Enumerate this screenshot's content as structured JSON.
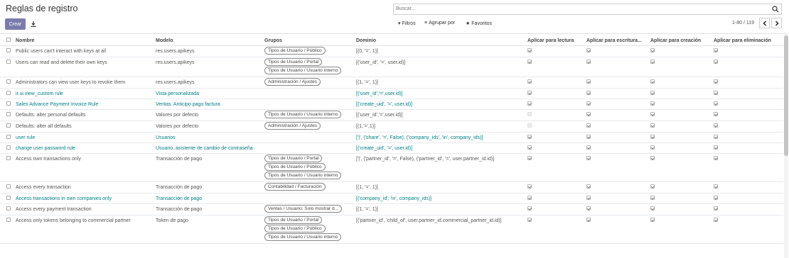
{
  "header": {
    "title": "Reglas de registro",
    "search_placeholder": "Buscar...",
    "create_label": "Crear",
    "filters_label": "Filtros",
    "groupby_label": "Agrupar por",
    "favorites_label": "Favoritos",
    "pager": "1-80 / 119"
  },
  "columns": {
    "name": "Nombre",
    "model": "Modelo",
    "groups": "Grupos",
    "domain": "Dominio",
    "read": "Aplicar para lectura",
    "write": "Aplicar para escritura...",
    "create": "Aplicar para creación",
    "unlink": "Aplicar para eliminación"
  },
  "rows": [
    {
      "name": "Public users can't interact with keys at all",
      "model": "res.users.apikeys",
      "groups": [
        "Tipos de Usuario / Público"
      ],
      "domain": "[(0, '=', 1)]",
      "perms": [
        true,
        true,
        true,
        true
      ],
      "link": false
    },
    {
      "name": "Users can read and delete their own keys",
      "model": "res.users.apikeys",
      "groups": [
        "Tipos de Usuario / Portal",
        "Tipos de Usuario / Usuario interno"
      ],
      "domain": "[('user_id', '=', user.id)]",
      "perms": [
        true,
        true,
        true,
        true
      ],
      "link": false
    },
    {
      "name": "Administrators can view user keys to revoke them",
      "model": "res.users.apikeys",
      "groups": [
        "Administración / Ajustes"
      ],
      "domain": "[(1, '=', 1)]",
      "perms": [
        true,
        true,
        true,
        true
      ],
      "link": false
    },
    {
      "name": "ir.ui.view_custom rule",
      "model": "Vista personalizada",
      "groups": [],
      "domain": "[('user_id','=',user.id)]",
      "perms": [
        true,
        true,
        true,
        true
      ],
      "link": true
    },
    {
      "name": "Sales Advance Payment Invoice Rule",
      "model": "Ventas. Anticipo pago factura",
      "groups": [],
      "domain": "[('create_uid', '=', user.id)]",
      "perms": [
        true,
        true,
        true,
        true
      ],
      "link": true
    },
    {
      "name": "Defaults: alter personal defaults",
      "model": "Valores por defecto",
      "groups": [
        "Tipos de Usuario / Usuario interno"
      ],
      "domain": "[('user_id','=',user.id)]",
      "perms": [
        false,
        true,
        true,
        true
      ],
      "link": false
    },
    {
      "name": "Defaults: alter all defaults",
      "model": "Valores por defecto",
      "groups": [
        "Administración / Ajustes"
      ],
      "domain": "[(1,'=',1)]",
      "perms": [
        false,
        true,
        true,
        true
      ],
      "link": false
    },
    {
      "name": "user rule",
      "model": "Usuarios",
      "groups": [],
      "domain": "['|', ('share', '=', False), ('company_ids', 'in', company_ids)]",
      "perms": [
        true,
        true,
        true,
        true
      ],
      "link": true
    },
    {
      "name": "change user password rule",
      "model": "Usuario, asistente de cambio de contraseña",
      "groups": [],
      "domain": "[('create_uid', '=', user.id)]",
      "perms": [
        true,
        true,
        true,
        true
      ],
      "link": true
    },
    {
      "name": "Access own transactions only",
      "model": "Transacción de pago",
      "groups": [
        "Tipos de Usuario / Portal",
        "Tipos de Usuario / Público",
        "Tipos de Usuario / Usuario interno"
      ],
      "domain": "['|', ('partner_id', '=', False), ('partner_id', '=', user.partner_id.id)]",
      "perms": [
        true,
        true,
        true,
        true
      ],
      "link": false
    },
    {
      "name": "Access every transaction",
      "model": "Transacción de pago",
      "groups": [
        "Contabilidad / Facturación"
      ],
      "domain": "[(1, '=', 1)]",
      "perms": [
        true,
        true,
        true,
        true
      ],
      "link": false
    },
    {
      "name": "Access transactions in own companies only",
      "model": "Transacción de pago",
      "groups": [],
      "domain": "[('company_id', 'in', company_ids)]",
      "perms": [
        true,
        true,
        true,
        true
      ],
      "link": true
    },
    {
      "name": "Access every payment transaction",
      "model": "Transacción de pago",
      "groups": [
        "Ventas / Usuario: Solo mostrar d..."
      ],
      "domain": "[(1, '=', 1)]",
      "perms": [
        true,
        true,
        true,
        true
      ],
      "link": false
    },
    {
      "name": "Access only tokens belonging to commercial partner",
      "model": "Token de pago",
      "groups": [
        "Tipos de Usuario / Portal",
        "Tipos de Usuario / Público",
        "Tipos de Usuario / Usuario interno"
      ],
      "domain": "[('partner_id', 'child_of', user.partner_id.commercial_partner_id.id)]",
      "perms": [
        true,
        true,
        true,
        true
      ],
      "link": false
    }
  ]
}
